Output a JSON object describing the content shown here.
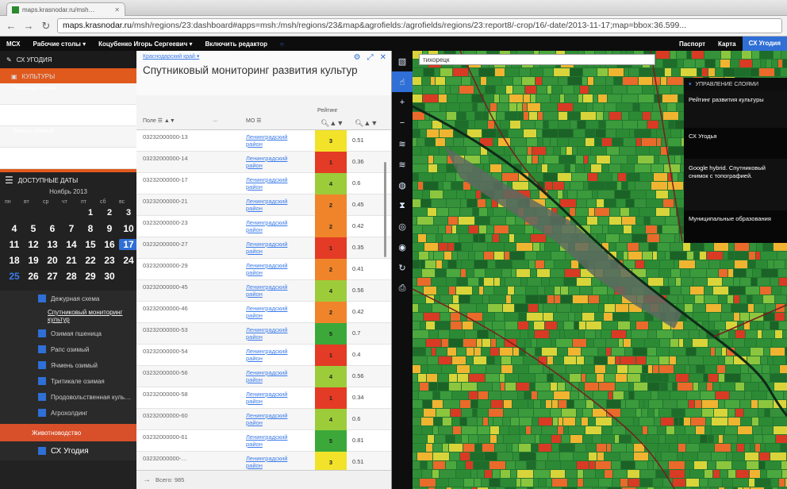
{
  "browser": {
    "tab_title": "maps.krasnodar.ru/msh…",
    "url_host": "maps.krasnodar.ru",
    "url_rest": "/msh/regions/23:dashboard#apps=msh:/msh/regions/23&map&agrofields:/agrofields/regions/23:report8/-crop/16/-date/2013-11-17;map=bbox:36.599..."
  },
  "appbar": {
    "left_items": [
      "МСХ",
      "Рабочие столы ▾",
      "Коцубенко Игорь Сергеевич ▾",
      "Включить редактор"
    ],
    "right_items": [
      "Паспорт",
      "Карта",
      "СХ Угодия"
    ]
  },
  "sidebar": {
    "header": "СХ УГОДИЯ",
    "cultures_header": "КУЛЬТУРЫ",
    "cultures": [
      "Пшеница озимая",
      "Рапс озимый",
      "Ячмень озимый",
      "Тритикале озимая"
    ],
    "dates_header": "ДОСТУПНЫЕ ДАТЫ",
    "month": "Ноябрь 2013",
    "dow": [
      "пн",
      "вт",
      "ср",
      "чт",
      "пт",
      "сб",
      "вс"
    ],
    "weeks": [
      [
        "",
        "",
        "",
        "",
        "1",
        "2",
        "3"
      ],
      [
        "4",
        "5",
        "6",
        "7",
        "8",
        "9",
        "10"
      ],
      [
        "11",
        "12",
        "13",
        "14",
        "15",
        "16",
        "17"
      ],
      [
        "18",
        "19",
        "20",
        "21",
        "22",
        "23",
        "24"
      ],
      [
        "25",
        "26",
        "27",
        "28",
        "29",
        "30",
        ""
      ]
    ],
    "layers": [
      "Дежурная схема",
      "Спутниковый мониторинг культур",
      "Озимая пшеница",
      "Рапс озимый",
      "Ячмень озимый",
      "Тритикале озимая",
      "Продовольственная куль…",
      "Агрохолдинг"
    ],
    "group": "Животноводство",
    "last_layer": "СХ Угодия"
  },
  "panel": {
    "breadcrumb": "Краснодарский край ▾",
    "title": "Спутниковый мониторинг развития культур",
    "col_field": "Поле",
    "col_dots": "…",
    "col_mo": "МО",
    "col_rating": "Рейтинг",
    "rows": [
      {
        "id": "03232000000-13",
        "mo": "Ленинградский район",
        "rank": "3",
        "value": "0.51",
        "color": "#f2e22a"
      },
      {
        "id": "03232000000-14",
        "mo": "Ленинградский район",
        "rank": "1",
        "value": "0.36",
        "color": "#e33b25"
      },
      {
        "id": "03232000000-17",
        "mo": "Ленинградский район",
        "rank": "4",
        "value": "0.6",
        "color": "#9ccc3a"
      },
      {
        "id": "03232000000-21",
        "mo": "Ленинградский район",
        "rank": "2",
        "value": "0.45",
        "color": "#f0842a"
      },
      {
        "id": "03232000000-23",
        "mo": "Ленинградский район",
        "rank": "2",
        "value": "0.42",
        "color": "#f0842a"
      },
      {
        "id": "03232000000-27",
        "mo": "Ленинградский район",
        "rank": "1",
        "value": "0.35",
        "color": "#e33b25"
      },
      {
        "id": "03232000000-29",
        "mo": "Ленинградский район",
        "rank": "2",
        "value": "0.41",
        "color": "#f0842a"
      },
      {
        "id": "03232000000-45",
        "mo": "Ленинградский район",
        "rank": "4",
        "value": "0.56",
        "color": "#9ccc3a"
      },
      {
        "id": "03232000000-46",
        "mo": "Ленинградский район",
        "rank": "2",
        "value": "0.42",
        "color": "#f0842a"
      },
      {
        "id": "03232000000-53",
        "mo": "Ленинградский район",
        "rank": "5",
        "value": "0.7",
        "color": "#3da83a"
      },
      {
        "id": "03232000000-54",
        "mo": "Ленинградский район",
        "rank": "1",
        "value": "0.4",
        "color": "#e33b25"
      },
      {
        "id": "03232000000-56",
        "mo": "Ленинградский район",
        "rank": "4",
        "value": "0.56",
        "color": "#9ccc3a"
      },
      {
        "id": "03232000000-58",
        "mo": "Ленинградский район",
        "rank": "1",
        "value": "0.34",
        "color": "#e33b25"
      },
      {
        "id": "03232000000-60",
        "mo": "Ленинградский район",
        "rank": "4",
        "value": "0.6",
        "color": "#9ccc3a"
      },
      {
        "id": "03232000000-61",
        "mo": "Ленинградский район",
        "rank": "5",
        "value": "0.81",
        "color": "#3da83a"
      },
      {
        "id": "03232000000-…",
        "mo": "Ленинградский район",
        "rank": "3",
        "value": "0.51",
        "color": "#f2e22a"
      }
    ],
    "footer_label": "Всего: 985"
  },
  "map": {
    "search_value": "тихорецк",
    "layers_header": "УПРАВЛЕНИЕ СЛОЯМИ",
    "layers": [
      "Рейтинг развития культуры",
      "СХ Угодья",
      "Google hybrid. Спутниковый снимок с топографией.",
      "Муниципальные образования"
    ]
  }
}
